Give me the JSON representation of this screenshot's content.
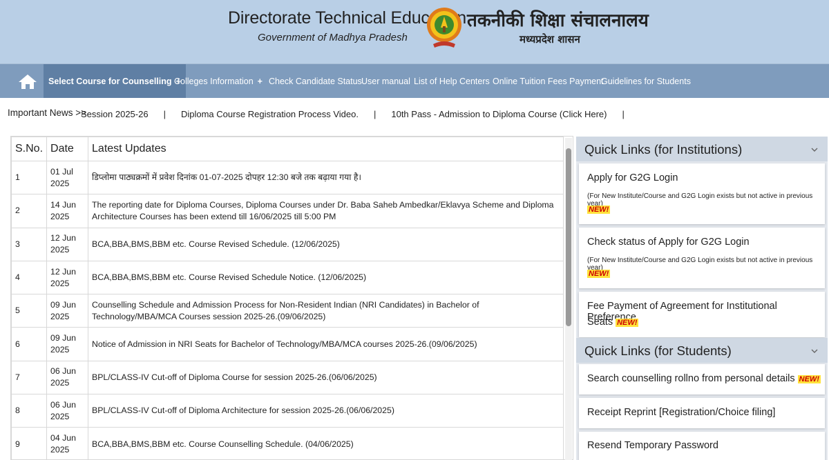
{
  "header": {
    "title_en": "Directorate Technical Education",
    "subtitle_en": "Government of Madhya Pradesh",
    "title_hi": "तकनीकी शिक्षा संचालनालय",
    "subtitle_hi": "मध्यप्रदेश शासन",
    "emblem_icon": "mp-emblem-icon"
  },
  "nav": {
    "home_icon": "home-icon",
    "items": [
      {
        "label": "Select Course for Counselling",
        "has_plus": true
      },
      {
        "label": "Colleges Information",
        "has_plus": true
      },
      {
        "label": "Check Candidate Status"
      },
      {
        "label": "User manual"
      },
      {
        "label": "List of Help Centers"
      },
      {
        "label": "Online Tuition Fees Payment"
      },
      {
        "label": "Guidelines for Students"
      }
    ],
    "plus_symbol": "+"
  },
  "news": {
    "label": "Important News >>",
    "items": [
      "Session 2025-26",
      "Diploma Course Registration Process Video.",
      "10th Pass - Admission to Diploma Course (Click Here)"
    ],
    "separator": "|"
  },
  "updates": {
    "columns": [
      "S.No.",
      "Date",
      "Latest Updates"
    ],
    "rows": [
      {
        "sno": "1",
        "date": "01 Jul 2025",
        "text": "डिप्लोमा पाठ्यक्रमों में प्रवेश दिनांक 01-07-2025 दोपहर 12:30 बजे तक बढ़ाया गया है।"
      },
      {
        "sno": "2",
        "date": "14 Jun 2025",
        "text": "The reporting date for Diploma Courses, Diploma Courses under Dr. Baba Saheb Ambedkar/Eklavya Scheme and Diploma Architecture Courses has been extend till 16/06/2025 till 5:00 PM"
      },
      {
        "sno": "3",
        "date": "12 Jun 2025",
        "text": "BCA,BBA,BMS,BBM etc. Course Revised Schedule. (12/06/2025)"
      },
      {
        "sno": "4",
        "date": "12 Jun 2025",
        "text": "BCA,BBA,BMS,BBM etc. Course Revised Schedule Notice. (12/06/2025)"
      },
      {
        "sno": "5",
        "date": "09 Jun 2025",
        "text": "Counselling Schedule and Admission Process for Non-Resident Indian (NRI Candidates) in Bachelor of Technology/MBA/MCA Courses session 2025-26.(09/06/2025)"
      },
      {
        "sno": "6",
        "date": "09 Jun 2025",
        "text": "Notice of Admission in NRI Seats for Bachelor of Technology/MBA/MCA courses 2025-26.(09/06/2025)"
      },
      {
        "sno": "7",
        "date": "06 Jun 2025",
        "text": "BPL/CLASS-IV Cut-off of Diploma Course for session 2025-26.(06/06/2025)"
      },
      {
        "sno": "8",
        "date": "06 Jun 2025",
        "text": "BPL/CLASS-IV Cut-off of Diploma Architecture for session 2025-26.(06/06/2025)"
      },
      {
        "sno": "9",
        "date": "04 Jun 2025",
        "text": "BCA,BBA,BMS,BBM etc. Course Counselling Schedule. (04/06/2025)"
      }
    ]
  },
  "quick_links_institutions": {
    "title": "Quick Links (for Institutions)",
    "items": [
      {
        "label": "Apply for G2G Login",
        "note": "(For New Institute/Course and G2G Login exists but not active in previous year)",
        "badge": "NEW!"
      },
      {
        "label": "Check status of Apply for G2G Login",
        "note": "(For New Institute/Course and G2G Login exists but not active in previous year)",
        "badge": "NEW!"
      },
      {
        "label_line1": "Fee Payment of Agreement for Institutional Preference",
        "label_line2": "Seats",
        "badge": "NEW!"
      }
    ]
  },
  "quick_links_students": {
    "title": "Quick Links (for Students)",
    "items": [
      {
        "label": "Search counselling rollno from personal details",
        "badge": "NEW!"
      },
      {
        "label": "Receipt Reprint [Registration/Choice filing]"
      },
      {
        "label": "Resend Temporary Password"
      }
    ]
  },
  "colors": {
    "header_bg": "#b9cfe6",
    "nav_bg": "#7f9cbd",
    "nav_active_bg": "#5f7fa4",
    "badge_bg": "#ffe23b",
    "badge_text": "#cc0000"
  }
}
